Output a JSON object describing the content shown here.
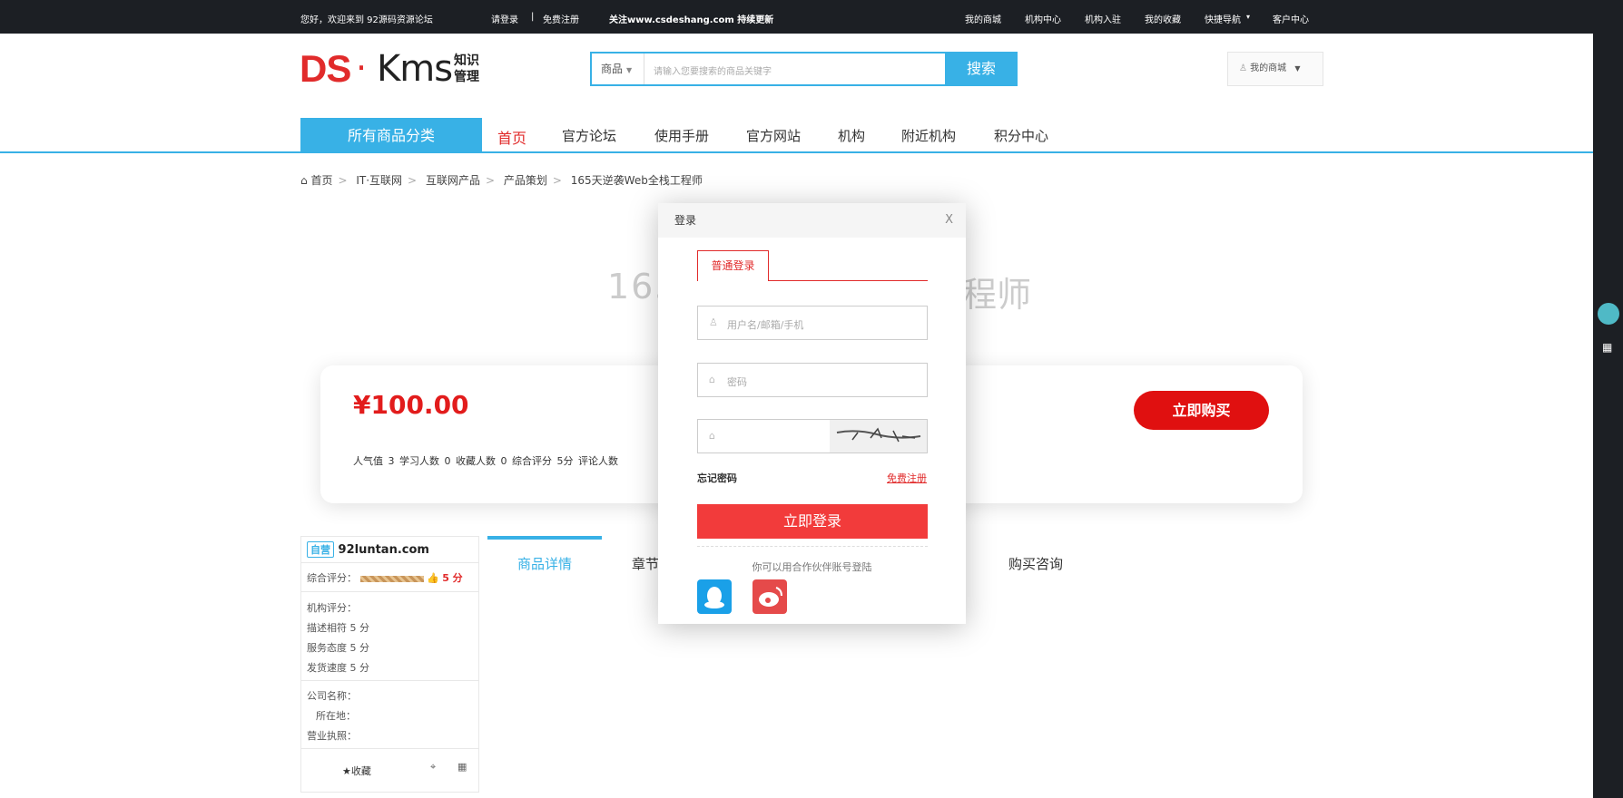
{
  "topbar": {
    "welcome": "您好，欢迎来到  92源码资源论坛",
    "login": "请登录",
    "sep": "|",
    "register": "免费注册",
    "follow": "关注www.csdeshang.com 持续更新",
    "links": [
      "我的商城",
      "机构中心",
      "机构入驻",
      "我的收藏",
      "快捷导航",
      "客户中心"
    ],
    "quicknav_arrow": "▾"
  },
  "logo": {
    "main": "DS",
    "dot": "·",
    "kms": "Kms",
    "sub": "知识管理"
  },
  "search": {
    "category": "商品",
    "placeholder": "请输入您要搜索的商品关键字",
    "button": "搜索"
  },
  "mymall": "我的商城",
  "nav": {
    "all_categories": "所有商品分类",
    "items": [
      "首页",
      "官方论坛",
      "使用手册",
      "官方网站",
      "机构",
      "附近机构",
      "积分中心"
    ]
  },
  "breadcrumb": [
    "首页",
    "IT·互联网",
    "互联网产品",
    "产品策划",
    "165天逆袭Web全栈工程师"
  ],
  "product": {
    "title_left": "165",
    "title_right": "程师",
    "price": "¥100.00",
    "stats": "人气值  3   学习人数  0   收藏人数  0   综合评分  5分   评论人数",
    "buy": "立即购买"
  },
  "store": {
    "badge": "自营",
    "name": "92luntan.com",
    "overall_label": "综合评分：",
    "overall_score": "5 分",
    "org_rating": "机构评分：",
    "desc": "描述相符 5 分",
    "service": "服务态度 5 分",
    "speed": "发货速度 5 分",
    "company": "公司名称：",
    "location": "所在地：",
    "license": "营业执照：",
    "favorite": "收藏"
  },
  "tabs": [
    "商品详情",
    "章节",
    "购买咨询"
  ],
  "login_modal": {
    "title": "登录",
    "close": "X",
    "tab": "普通登录",
    "username_placeholder": "用户名/邮箱/手机",
    "password_placeholder": "密码",
    "forgot": "忘记密码",
    "register": "免费注册",
    "login": "立即登录",
    "partner": "你可以用合作伙伴账号登陆"
  },
  "colors": {
    "accent": "#38b1e6",
    "brand_red": "#e12b2b",
    "topbar": "#1c1f24"
  }
}
